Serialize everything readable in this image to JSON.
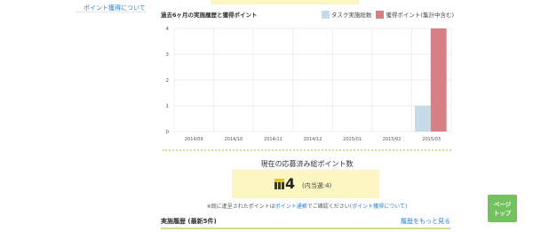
{
  "sidebar": {
    "link_label": "ポイント獲得について"
  },
  "chart_section": {
    "title": "過去6ヶ月の実施履歴と獲得ポイント",
    "legend": [
      {
        "label": "タスク実施総数",
        "color": "#c6dae8"
      },
      {
        "label": "獲得ポイント(集計中含む)",
        "color": "#d87f85"
      }
    ]
  },
  "chart_data": {
    "type": "bar",
    "categories": [
      "2014/09",
      "2014/10",
      "2014/11",
      "2014/12",
      "2015/01",
      "2015/02",
      "2015/03"
    ],
    "series": [
      {
        "name": "タスク実施総数",
        "values": [
          0,
          0,
          0,
          0,
          0,
          0,
          1
        ]
      },
      {
        "name": "獲得ポイント(集計中含む)",
        "values": [
          0,
          0,
          0,
          0,
          0,
          0,
          4
        ]
      }
    ],
    "ylim": [
      0,
      4
    ],
    "yticks": [
      "0",
      "1",
      "2",
      "3",
      "4"
    ],
    "grid": true,
    "legend_position": "top-right",
    "colors": [
      "#c6dae8",
      "#d87f85"
    ]
  },
  "points": {
    "title": "現在の応募済み総ポイント数",
    "value": "4",
    "sub": "(内当選:4)"
  },
  "note": {
    "prefix": "※既に進呈されたポイントは",
    "link1": "ポイント通帳",
    "middle": "でご確認ください",
    "link2": "(ポイント獲得について)"
  },
  "history": {
    "title": "実施履歴 (最新5件)",
    "more_label": "履歴をもっと見る"
  },
  "page_top": {
    "line1": "ページ",
    "line2": "トップ"
  }
}
